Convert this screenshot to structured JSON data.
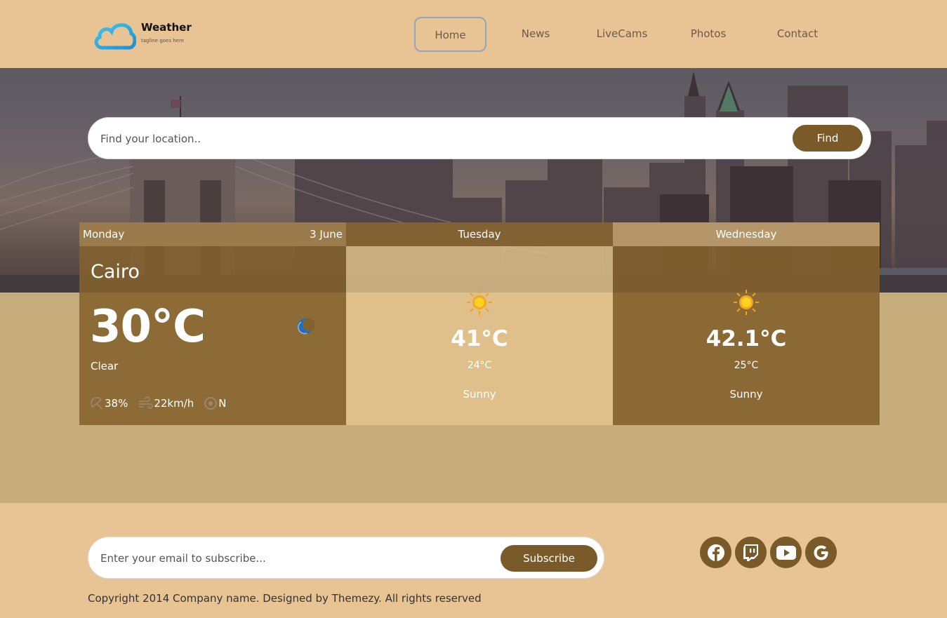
{
  "header": {
    "logo_title": "Weather",
    "logo_tagline": "tagline goes here",
    "nav": [
      "Home",
      "News",
      "LiveCams",
      "Photos",
      "Contact"
    ]
  },
  "search": {
    "placeholder": "Find your location..",
    "button": "Find"
  },
  "forecast": {
    "today": {
      "day": "Monday",
      "date": "3 June",
      "city": "Cairo",
      "temp": "30°C",
      "condition": "Clear",
      "icon": "moon-icon",
      "humidity": "38%",
      "wind": "22km/h",
      "direction": "N"
    },
    "days": [
      {
        "day": "Tuesday",
        "max": "41°C",
        "min": "24°C",
        "condition": "Sunny",
        "icon": "sun-icon"
      },
      {
        "day": "Wednesday",
        "max": "42.1°C",
        "min": "25°C",
        "condition": "Sunny",
        "icon": "sun-icon"
      }
    ]
  },
  "footer": {
    "subscribe_placeholder": "Enter your email to subscribe...",
    "subscribe_button": "Subscribe",
    "socials": [
      "facebook-icon",
      "twitch-icon",
      "youtube-icon",
      "google-icon"
    ],
    "copyright": "Copyright 2014 Company name. Designed by Themezy. All rights reserved"
  },
  "colors": {
    "page_bg": "#e8c394",
    "button_brown": "#7b5a2a",
    "content_bg": "#c8ad7c"
  }
}
